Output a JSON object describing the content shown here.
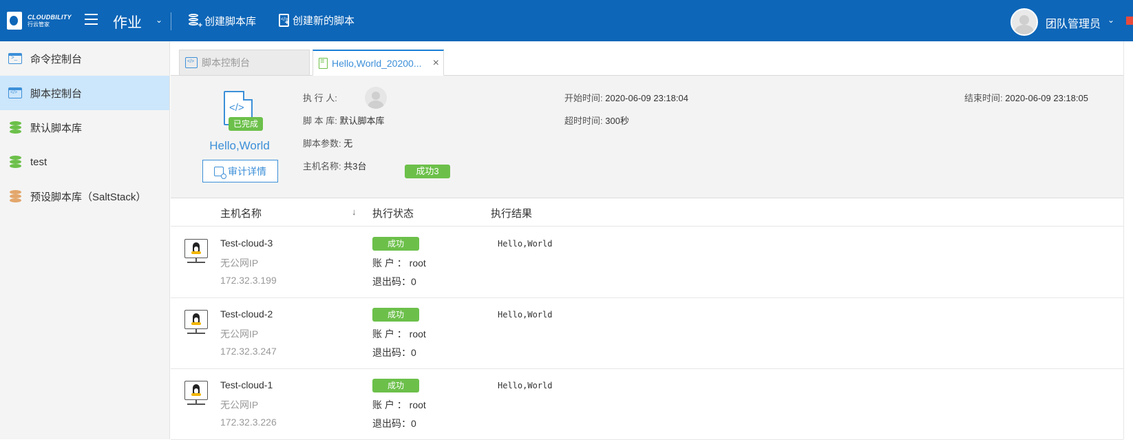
{
  "header": {
    "logo_en": "CLOUDBILITY",
    "logo_cn": "行云管家",
    "module_title": "作业",
    "create_library_label": "创建脚本库",
    "create_script_label": "创建新的脚本",
    "user_name": "团队管理员"
  },
  "sidebar": {
    "items": [
      {
        "label": "命令控制台",
        "icon": "terminal-icon"
      },
      {
        "label": "脚本控制台",
        "icon": "code-window-icon"
      },
      {
        "label": "默认脚本库",
        "icon": "database-icon"
      },
      {
        "label": "test",
        "icon": "database-icon"
      },
      {
        "label": "预设脚本库（SaltStack）",
        "icon": "database-icon"
      }
    ],
    "active_index": 1
  },
  "tabs": [
    {
      "label": "脚本控制台"
    },
    {
      "label": "Hello,World_20200..."
    }
  ],
  "detail": {
    "status_badge": "已完成",
    "script_name": "Hello,World",
    "audit_label": "审计详情",
    "executor_key": "执 行 人:",
    "library_key": "脚 本 库:",
    "library_value": "默认脚本库",
    "params_key": "脚本参数:",
    "params_value": "无",
    "hosts_key": "主机名称:",
    "hosts_value": "共3台",
    "success_count": "成功3",
    "start_key": "开始时间:",
    "start_value": "2020-06-09 23:18:04",
    "timeout_key": "超时时间:",
    "timeout_value": "300秒",
    "end_key": "结束时间:",
    "end_value": "2020-06-09 23:18:05"
  },
  "table": {
    "headers": {
      "host": "主机名称",
      "status": "执行状态",
      "result": "执行结果"
    },
    "rows": [
      {
        "host": "Test-cloud-3",
        "public_ip": "无公网IP",
        "ip": "172.32.3.199",
        "status": "成功",
        "account": "账 户 ： root",
        "exit_code": "退出码：0",
        "result": "Hello,World"
      },
      {
        "host": "Test-cloud-2",
        "public_ip": "无公网IP",
        "ip": "172.32.3.247",
        "status": "成功",
        "account": "账 户 ： root",
        "exit_code": "退出码：0",
        "result": "Hello,World"
      },
      {
        "host": "Test-cloud-1",
        "public_ip": "无公网IP",
        "ip": "172.32.3.226",
        "status": "成功",
        "account": "账 户 ： root",
        "exit_code": "退出码：0",
        "result": "Hello,World"
      }
    ]
  },
  "colors": {
    "primary": "#0d66b8",
    "accent": "#3c8fd8",
    "success": "#6cc04a",
    "sidebar_active": "#cce6fb"
  }
}
